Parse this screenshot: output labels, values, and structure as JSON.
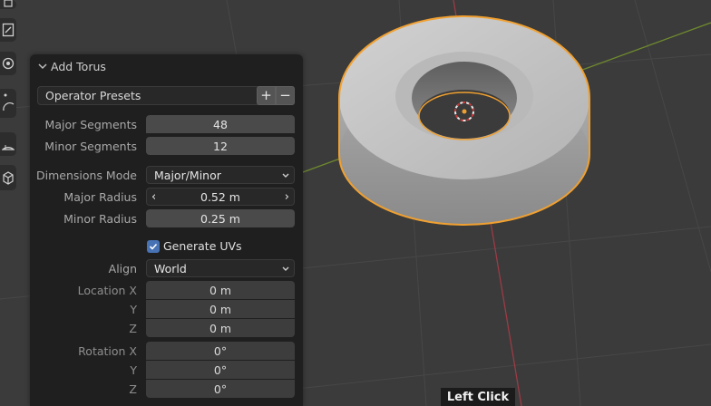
{
  "panel": {
    "title": "Add Torus",
    "presets": {
      "label": "Operator Presets",
      "add_symbol": "+",
      "remove_symbol": "−"
    },
    "major_segments": {
      "label": "Major Segments",
      "value": "48"
    },
    "minor_segments": {
      "label": "Minor Segments",
      "value": "12"
    },
    "dimensions_mode": {
      "label": "Dimensions Mode",
      "value": "Major/Minor"
    },
    "major_radius": {
      "label": "Major Radius",
      "value": "0.52 m",
      "dec": "‹",
      "inc": "›"
    },
    "minor_radius": {
      "label": "Minor Radius",
      "value": "0.25 m"
    },
    "generate_uvs": {
      "label": "Generate UVs",
      "checked": true
    },
    "align": {
      "label": "Align",
      "value": "World"
    },
    "location": {
      "x_label": "Location X",
      "y_label": "Y",
      "z_label": "Z",
      "x": "0 m",
      "y": "0 m",
      "z": "0 m"
    },
    "rotation": {
      "x_label": "Rotation X",
      "y_label": "Y",
      "z_label": "Z",
      "x": "0°",
      "y": "0°",
      "z": "0°"
    }
  },
  "toolbar": {
    "icons": [
      "transform-icon",
      "annotate-icon",
      "measure-icon",
      "cursor-icon",
      "rotate-icon",
      "add-cube-icon"
    ]
  },
  "tooltip": {
    "text": "Left Click"
  },
  "colors": {
    "viewport_bg": "#3b3b3b",
    "panel_bg": "#1e1e1e",
    "field_bg": "#545454",
    "selection_outline": "#f0a030",
    "x_axis": "#9c3b46",
    "y_axis": "#6f8a2e",
    "checkbox_accent": "#4772b3"
  }
}
